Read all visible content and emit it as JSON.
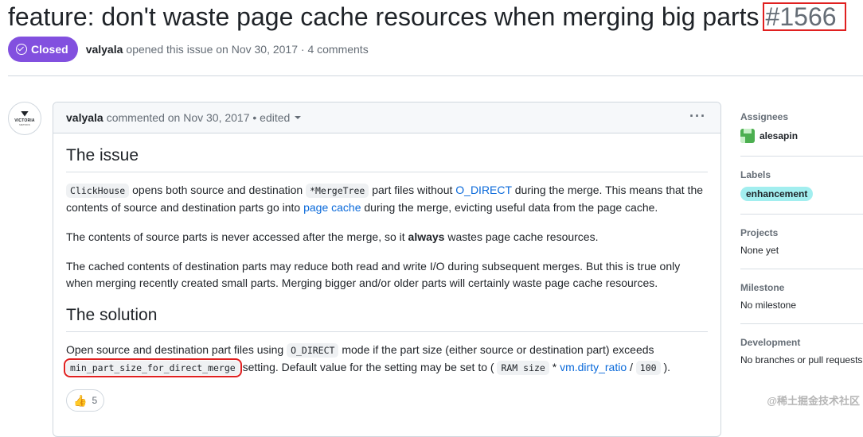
{
  "issue": {
    "title": "feature: don't waste page cache resources when merging big parts",
    "number": "#1566",
    "state": "Closed",
    "author": "valyala",
    "meta_text": "opened this issue on Nov 30, 2017 · 4 comments"
  },
  "avatar": {
    "line1": "VICTORIA",
    "line2": "METRICS"
  },
  "comment": {
    "author": "valyala",
    "meta": "commented on Nov 30, 2017 • edited",
    "menu": "···",
    "h_issue": "The issue",
    "p1": {
      "code1": "ClickHouse",
      "t1": " opens both source and destination ",
      "code2": "*MergeTree",
      "t2": " part files without ",
      "link1": "O_DIRECT",
      "t3": " during the merge. This means that the contents of source and destination parts go into ",
      "link2": "page cache",
      "t4": " during the merge, evicting useful data from the page cache."
    },
    "p2": {
      "t1": "The contents of source parts is never accessed after the merge, so it ",
      "bold": "always",
      "t2": " wastes page cache resources."
    },
    "p3": "The cached contents of destination parts may reduce both read and write I/O during subsequent merges. But this is true only when merging recently created small parts. Merging bigger and/or older parts will certainly waste page cache resources.",
    "h_solution": "The solution",
    "p4": {
      "t1": "Open source and destination part files using ",
      "code1": "O_DIRECT",
      "t2": " mode if the part size (either source or destination part) exceeds ",
      "code2": "min_part_size_for_direct_merge",
      "t3": " setting. Default value for the setting may be set to ( ",
      "code3": "RAM size",
      "t4": " * ",
      "link": "vm.dirty_ratio",
      "t5": " / ",
      "code4": "100",
      "t6": " )."
    },
    "reaction": {
      "emoji": "👍",
      "count": "5"
    }
  },
  "sidebar": {
    "assignees_label": "Assignees",
    "assignee": "alesapin",
    "labels_label": "Labels",
    "label": "enhancement",
    "projects_label": "Projects",
    "projects_value": "None yet",
    "milestone_label": "Milestone",
    "milestone_value": "No milestone",
    "development_label": "Development",
    "development_value": "No branches or pull requests"
  },
  "watermark": "@稀土掘金技术社区",
  "colors": {
    "closed": "#8250df",
    "link": "#0969da",
    "label_bg": "#a2eeef",
    "highlight": "#e02020"
  }
}
